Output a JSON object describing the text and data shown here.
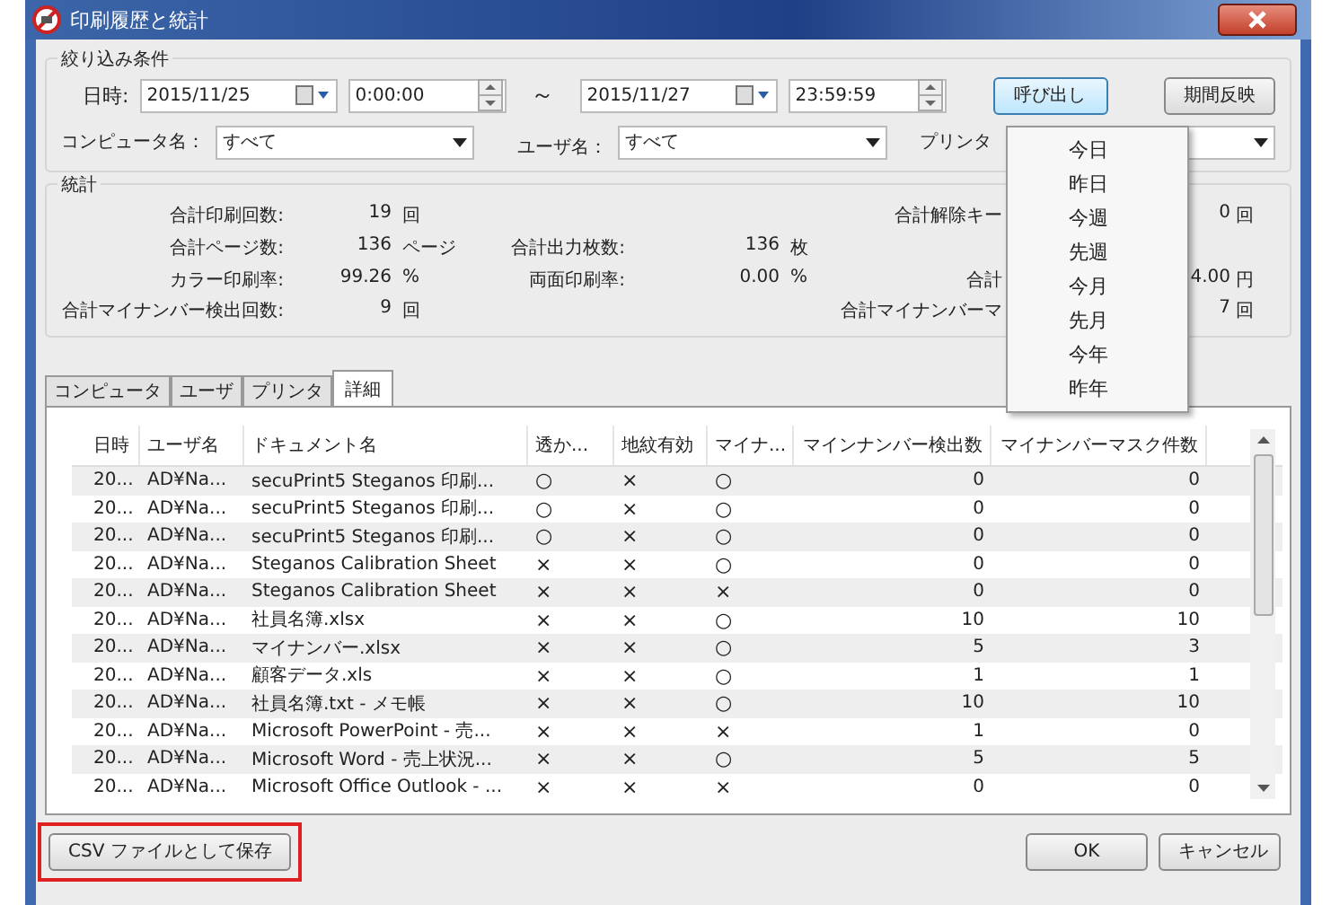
{
  "window": {
    "title": "印刷履歴と統計"
  },
  "filter": {
    "group_label": "絞り込み条件",
    "date_label": "日時:",
    "from_date": "2015/11/25",
    "from_time": "0:00:00",
    "tilde": "～",
    "to_date": "2015/11/27",
    "to_time": "23:59:59",
    "call_button": "呼び出し",
    "reflect_button": "期間反映",
    "computer_label": "コンピュータ名：",
    "computer_value": "すべて",
    "user_label": "ユーザ名：",
    "user_value": "すべて",
    "printer_label": "プリンタ"
  },
  "stats": {
    "group_label": "統計",
    "rows": [
      {
        "left": {
          "label": "合計印刷回数:",
          "value": "19",
          "unit": "回"
        },
        "right": {
          "label": "合計解除キー",
          "value": "0",
          "unit": "回"
        }
      },
      {
        "left": {
          "label": "合計ページ数:",
          "value": "136",
          "unit": "ページ"
        },
        "middle": {
          "label": "合計出力枚数:",
          "value": "136",
          "unit": "枚"
        }
      },
      {
        "left": {
          "label": "カラー印刷率:",
          "value": "99.26",
          "unit": "%"
        },
        "middle": {
          "label": "両面印刷率:",
          "value": "0.00",
          "unit": "%"
        },
        "right": {
          "label": "合計",
          "value": "4.00",
          "unit": "円"
        }
      },
      {
        "left": {
          "label": "合計マイナンバー検出回数:",
          "value": "9",
          "unit": "回"
        },
        "right": {
          "label": "合計マイナンバーマ",
          "value": "7",
          "unit": "回"
        }
      }
    ]
  },
  "tabs": [
    {
      "label": "コンピュータ",
      "selected": false
    },
    {
      "label": "ユーザ",
      "selected": false
    },
    {
      "label": "プリンタ",
      "selected": false
    },
    {
      "label": "詳細",
      "selected": true
    }
  ],
  "table": {
    "columns": [
      "日時",
      "ユーザ名",
      "ドキュメント名",
      "透か...",
      "地紋有効",
      "マイナ...",
      "マインナンバー検出数",
      "マイナンバーマスク件数"
    ],
    "rows": [
      [
        "20...",
        "AD¥Na...",
        "secuPrint5 Steganos 印刷...",
        "○",
        "×",
        "○",
        "0",
        "0"
      ],
      [
        "20...",
        "AD¥Na...",
        "secuPrint5 Steganos 印刷...",
        "○",
        "×",
        "○",
        "0",
        "0"
      ],
      [
        "20...",
        "AD¥Na...",
        "secuPrint5 Steganos 印刷...",
        "○",
        "×",
        "○",
        "0",
        "0"
      ],
      [
        "20...",
        "AD¥Na...",
        "Steganos Calibration Sheet",
        "×",
        "×",
        "○",
        "0",
        "0"
      ],
      [
        "20...",
        "AD¥Na...",
        "Steganos Calibration Sheet",
        "×",
        "×",
        "×",
        "0",
        "0"
      ],
      [
        "20...",
        "AD¥Na...",
        "社員名簿.xlsx",
        "×",
        "×",
        "○",
        "10",
        "10"
      ],
      [
        "20...",
        "AD¥Na...",
        "マイナンバー.xlsx",
        "×",
        "×",
        "○",
        "5",
        "3"
      ],
      [
        "20...",
        "AD¥Na...",
        "顧客データ.xls",
        "×",
        "×",
        "○",
        "1",
        "1"
      ],
      [
        "20...",
        "AD¥Na...",
        "社員名簿.txt - メモ帳",
        "×",
        "×",
        "○",
        "10",
        "10"
      ],
      [
        "20...",
        "AD¥Na...",
        "Microsoft PowerPoint - 売...",
        "×",
        "×",
        "×",
        "1",
        "0"
      ],
      [
        "20...",
        "AD¥Na...",
        "Microsoft Word - 売上状況...",
        "×",
        "×",
        "○",
        "5",
        "5"
      ],
      [
        "20...",
        "AD¥Na...",
        "Microsoft Office Outlook - ...",
        "×",
        "×",
        "×",
        "0",
        "0"
      ]
    ]
  },
  "popup_menu": {
    "items": [
      "今日",
      "昨日",
      "今週",
      "先週",
      "今月",
      "先月",
      "今年",
      "昨年"
    ]
  },
  "footer": {
    "csv_button": {
      "label": "CSV ファイルとして保存",
      "highlighted": true
    },
    "ok_button": "OK",
    "cancel_button": "キャンセル"
  }
}
